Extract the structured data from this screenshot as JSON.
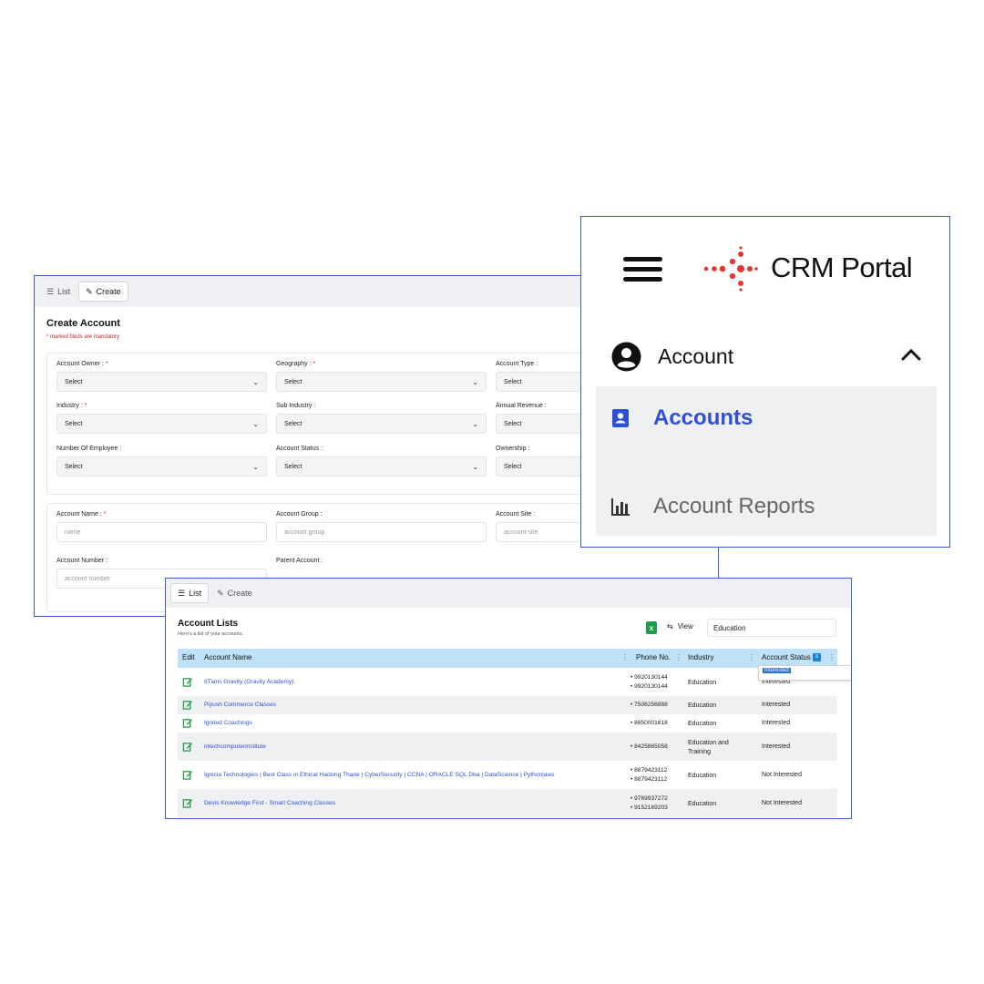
{
  "create_panel": {
    "tabs": [
      {
        "label": "List",
        "icon": "list-icon",
        "active": false
      },
      {
        "label": "Create",
        "icon": "pencil-icon",
        "active": true
      }
    ],
    "title": "Create Account",
    "mandatory_note": "* marked fileds are mandatory",
    "section1": [
      {
        "label": "Account Owner :",
        "required": true,
        "value": "Select"
      },
      {
        "label": "Geography :",
        "required": true,
        "value": "Select"
      },
      {
        "label": "Account Type :",
        "required": false,
        "value": "Select"
      },
      {
        "label": "Industry :",
        "required": true,
        "value": "Select"
      },
      {
        "label": "Sub Industry :",
        "required": false,
        "value": "Select"
      },
      {
        "label": "Annual Revenue :",
        "required": false,
        "value": "Select"
      },
      {
        "label": "Number Of Employee :",
        "required": false,
        "value": "Select"
      },
      {
        "label": "Account Status :",
        "required": false,
        "value": "Select"
      },
      {
        "label": "Ownership :",
        "required": false,
        "value": "Select"
      }
    ],
    "section2": [
      {
        "label": "Account Name :",
        "required": true,
        "placeholder": "name"
      },
      {
        "label": "Account Group :",
        "required": false,
        "placeholder": "account group"
      },
      {
        "label": "Account Site :",
        "required": false,
        "placeholder": "account site"
      },
      {
        "label": "Account Number :",
        "required": false,
        "placeholder": "account number"
      },
      {
        "label": "Parent Account :",
        "required": false,
        "placeholder": ""
      }
    ]
  },
  "menu_panel": {
    "brand": "CRM Portal",
    "logo_color": "#e03a2f",
    "account_label": "Account",
    "submenu": [
      {
        "label": "Accounts",
        "icon": "contact-card-icon",
        "active": true
      },
      {
        "label": "Account Reports",
        "icon": "bar-chart-icon",
        "active": false
      }
    ],
    "active_color": "#2f50d6"
  },
  "list_panel": {
    "tabs": [
      {
        "label": "List",
        "icon": "list-icon",
        "active": true
      },
      {
        "label": "Create",
        "icon": "pencil-icon",
        "active": false
      }
    ],
    "title": "Account Lists",
    "subtitle": "Here's a list of your accounts.",
    "view_label": "View",
    "search_value": "Education",
    "columns": [
      "Edit",
      "Account Name",
      "Phone No.",
      "Industry",
      "Account Status"
    ],
    "status_filter_option": "Interested",
    "rows": [
      {
        "name": "IITians Gravity (Gravity Academy)",
        "phones": [
          "9920130144",
          "9920130144"
        ],
        "industry": "Education",
        "status": "Interested"
      },
      {
        "name": "Piyush Commerce Classes",
        "phones": [
          "7506256888"
        ],
        "industry": "Education",
        "status": "Interested"
      },
      {
        "name": "Ignited Coachings",
        "phones": [
          "8850001618"
        ],
        "industry": "Education",
        "status": "Interested"
      },
      {
        "name": "intechcomputerinstitute",
        "phones": [
          "8425865058"
        ],
        "industry": "Education and Training",
        "status": "Interested"
      },
      {
        "name": "Ignicia Technologies | Best Class in Ethical Hacking Thane | CyberSecurity | CCNA | ORACLE SQL Dba | DataScience | Python|aws",
        "phones": [
          "8879423112",
          "8879423112"
        ],
        "industry": "Education",
        "status": "Not Interested"
      },
      {
        "name": "Devis Knowledge First - Smart Coaching Classes",
        "phones": [
          "9769937272",
          "9152169203"
        ],
        "industry": "Education",
        "status": "Not Interested"
      }
    ]
  }
}
